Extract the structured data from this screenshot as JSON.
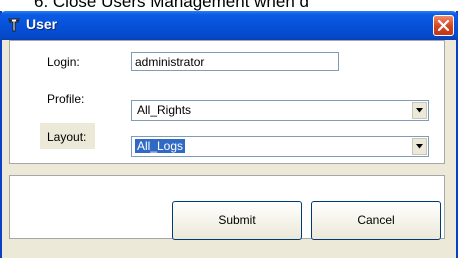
{
  "doc_fragment": "6.   Close Users Management when d",
  "window": {
    "title": "User"
  },
  "form": {
    "login_label": "Login:",
    "login_value": "administrator",
    "profile_label": "Profile:",
    "profile_value": "All_Rights",
    "layout_label": "Layout:",
    "layout_value": "All_Logs"
  },
  "buttons": {
    "submit": "Submit",
    "cancel": "Cancel"
  },
  "icons": {
    "app": "app-logo-icon",
    "close": "close-icon",
    "dropdown": "chevron-down-icon"
  },
  "colors": {
    "titlebar": "#0651d8",
    "selection": "#316ac5",
    "close": "#d6431e"
  }
}
